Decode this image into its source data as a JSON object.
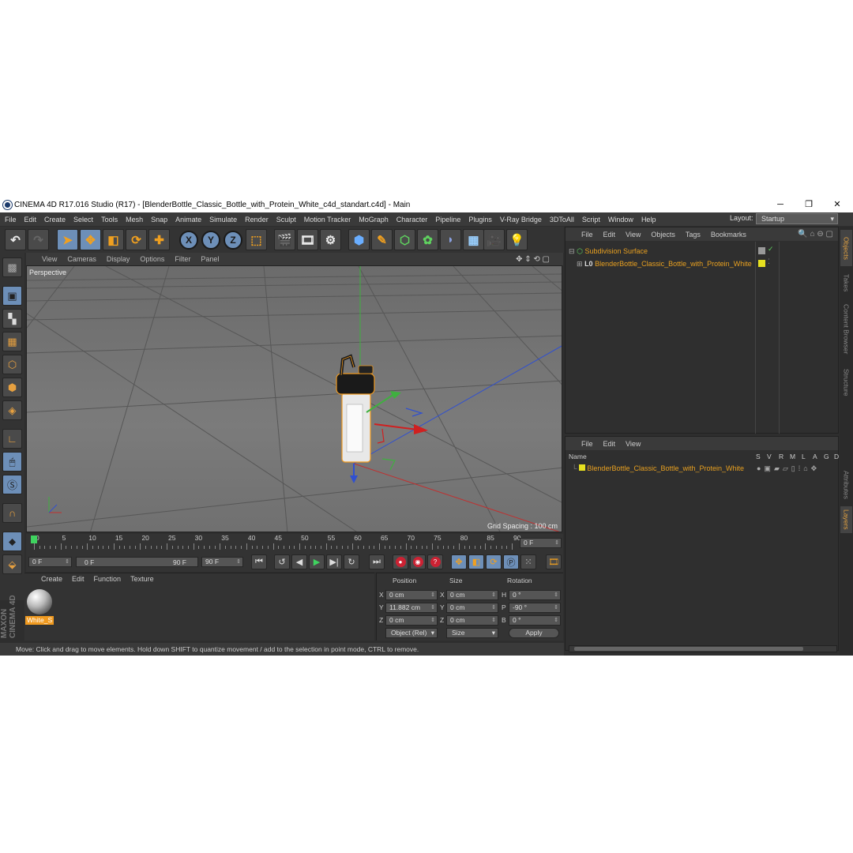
{
  "window": {
    "title": "CINEMA 4D R17.016 Studio (R17) - [BlenderBottle_Classic_Bottle_with_Protein_White_c4d_standart.c4d] - Main",
    "minimize": "─",
    "maximize": "❐",
    "close": "✕"
  },
  "menu": [
    "File",
    "Edit",
    "Create",
    "Select",
    "Tools",
    "Mesh",
    "Snap",
    "Animate",
    "Simulate",
    "Render",
    "Sculpt",
    "Motion Tracker",
    "MoGraph",
    "Character",
    "Pipeline",
    "Plugins",
    "V-Ray Bridge",
    "3DToAll",
    "Script",
    "Window",
    "Help"
  ],
  "layout": {
    "label": "Layout:",
    "value": "Startup"
  },
  "toolbar": {
    "x": "X",
    "y": "Y",
    "z": "Z"
  },
  "viewport": {
    "menu": [
      "View",
      "Cameras",
      "Display",
      "Options",
      "Filter",
      "Panel"
    ],
    "label": "Perspective",
    "grid_spacing": "Grid Spacing : 100 cm"
  },
  "timeline": {
    "ticks": [
      "0",
      "5",
      "10",
      "15",
      "20",
      "25",
      "30",
      "35",
      "40",
      "45",
      "50",
      "55",
      "60",
      "65",
      "70",
      "75",
      "80",
      "85",
      "90"
    ],
    "current": "0 F",
    "start": "0 F",
    "range_start": "0 F",
    "range_end": "90 F",
    "end": "90 F"
  },
  "materials": {
    "menu": [
      "Create",
      "Edit",
      "Function",
      "Texture"
    ],
    "items": [
      {
        "name": "White_S"
      }
    ]
  },
  "coordinates": {
    "headers": {
      "position": "Position",
      "size": "Size",
      "rotation": "Rotation"
    },
    "rows": [
      {
        "axis": "X",
        "pos": "0 cm",
        "saxis": "X",
        "size": "0 cm",
        "raxis": "H",
        "rot": "0 °"
      },
      {
        "axis": "Y",
        "pos": "11.882 cm",
        "saxis": "Y",
        "size": "0 cm",
        "raxis": "P",
        "rot": "-90 °"
      },
      {
        "axis": "Z",
        "pos": "0 cm",
        "saxis": "Z",
        "size": "0 cm",
        "raxis": "B",
        "rot": "0 °"
      }
    ],
    "mode": "Object (Rel)",
    "size_mode": "Size",
    "apply": "Apply"
  },
  "status": "Move: Click and drag to move elements. Hold down SHIFT to quantize movement / add to the selection in point mode, CTRL to remove.",
  "objects": {
    "menu": [
      "File",
      "Edit",
      "View",
      "Objects",
      "Tags",
      "Bookmarks"
    ],
    "items": [
      {
        "name": "Subdivision Surface"
      },
      {
        "name": "BlenderBottle_Classic_Bottle_with_Protein_White"
      }
    ]
  },
  "layers": {
    "menu": [
      "File",
      "Edit",
      "View"
    ],
    "name_header": "Name",
    "col_headers": [
      "S",
      "V",
      "R",
      "M",
      "L",
      "A",
      "G",
      "D"
    ],
    "items": [
      {
        "name": "BlenderBottle_Classic_Bottle_with_Protein_White"
      }
    ]
  },
  "right_tabs": [
    "Objects",
    "Takes",
    "Content Browser",
    "Structure",
    "Attributes",
    "Layers"
  ],
  "branding": "MAXON CINEMA 4D",
  "colors": {
    "accent": "#e8a020",
    "selection": "#6d8fb8",
    "background": "#2e2e2e"
  }
}
